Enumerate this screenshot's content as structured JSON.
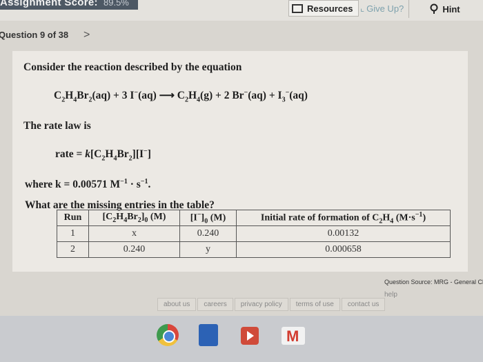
{
  "topbar": {
    "score_label": "Assignment Score:",
    "score_value": "89.5%",
    "resources_label": "Resources",
    "giveup_label": "Give Up?",
    "hint_label": "Hint"
  },
  "nav": {
    "question_label": "Question 9 of 38",
    "next_arrow": ">"
  },
  "question": {
    "prompt": "Consider the reaction described by the equation",
    "rate_law_intro": "The rate law is",
    "where_k": "where k = 0.00571 M",
    "missing_prompt": "What are the missing entries in the table?"
  },
  "table": {
    "headers": {
      "run": "Run",
      "initial_rate": "Initial rate of formation of C"
    },
    "rows": [
      {
        "run": "1",
        "c2h4br2": "x",
        "iodide": "0.240",
        "rate": "0.00132"
      },
      {
        "run": "2",
        "c2h4br2": "0.240",
        "iodide": "y",
        "rate": "0.000658"
      }
    ]
  },
  "footer": {
    "source": "Question Source: MRG - General Ch",
    "help": "help",
    "links": [
      "about us",
      "careers",
      "privacy policy",
      "terms of use",
      "contact us"
    ]
  }
}
